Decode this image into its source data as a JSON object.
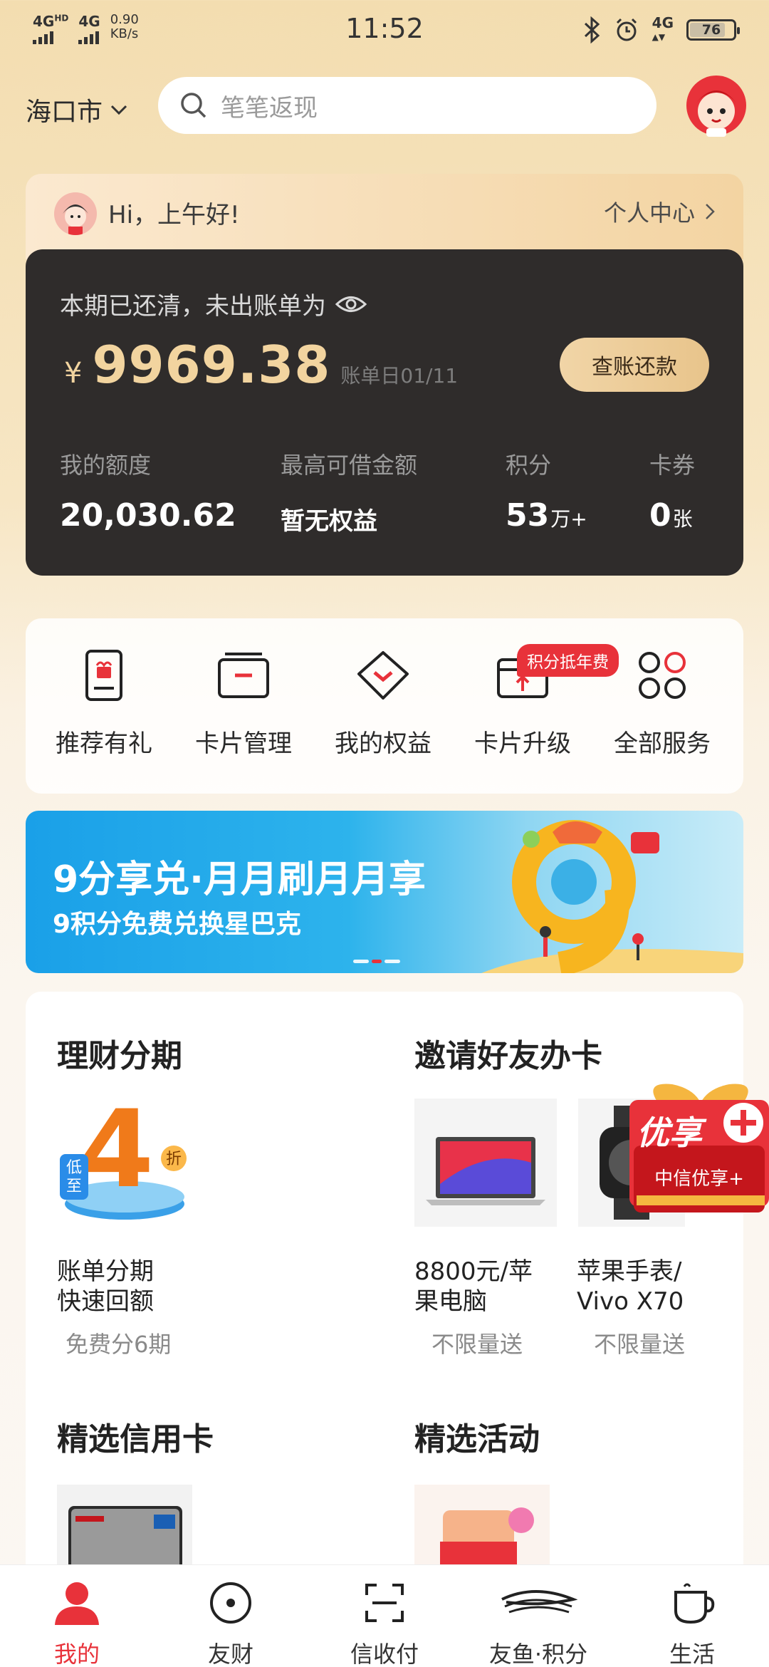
{
  "status_bar": {
    "sig1": "4G",
    "sig1_sup": "HD",
    "sig2": "4G",
    "speed_value": "0.90",
    "speed_unit": "KB/s",
    "time": "11:52",
    "net_right": "4G",
    "battery": "76"
  },
  "header": {
    "city": "海口市",
    "search_placeholder": "笔笔返现"
  },
  "account": {
    "greeting": "Hi，上午好!",
    "profile_link": "个人中心",
    "bill_status": "本期已还清，未出账单为",
    "currency": "¥",
    "amount": "9969.38",
    "due_label": "账单日01/11",
    "pay_button": "查账还款",
    "stats": [
      {
        "label": "我的额度",
        "value": "20,030.62",
        "unit": ""
      },
      {
        "label": "最高可借金额",
        "value": "暂无权益",
        "unit": ""
      },
      {
        "label": "积分",
        "value": "53",
        "unit": "万+"
      },
      {
        "label": "卡券",
        "value": "0",
        "unit": "张"
      }
    ]
  },
  "services": {
    "badge": "积分抵年费",
    "items": [
      {
        "label": "推荐有礼",
        "icon": "gift-box-icon"
      },
      {
        "label": "卡片管理",
        "icon": "card-icon"
      },
      {
        "label": "我的权益",
        "icon": "diamond-icon"
      },
      {
        "label": "卡片升级",
        "icon": "card-upgrade-icon"
      },
      {
        "label": "全部服务",
        "icon": "grid-icon"
      }
    ]
  },
  "banner": {
    "title": "9分享兑·月月刷月月享",
    "subtitle": "9积分免费兑换星巴克"
  },
  "sections": {
    "finance_title": "理财分期",
    "invite_title": "邀请好友办卡",
    "finance_product": {
      "badge_top": "低",
      "badge_bottom": "至",
      "number": "4",
      "discount": "折",
      "name_line1": "账单分期",
      "name_line2": "快速回额",
      "tag": "免费分6期"
    },
    "invite_products": [
      {
        "name_line1": "8800元/苹",
        "name_line2": "果电脑",
        "tag": "不限量送"
      },
      {
        "name_line1": "苹果手表/",
        "name_line2": "Vivo X70",
        "tag": "不限量送"
      }
    ],
    "cards_title": "精选信用卡",
    "activity_title": "精选活动"
  },
  "float_ad": {
    "title": "优享",
    "subtitle": "中信优享+"
  },
  "bottom_nav": [
    {
      "label": "我的",
      "icon": "person-icon",
      "active": true
    },
    {
      "label": "友财",
      "icon": "coin-icon",
      "active": false
    },
    {
      "label": "信收付",
      "icon": "scan-icon",
      "active": false
    },
    {
      "label": "友鱼·积分",
      "icon": "fish-icon",
      "active": false
    },
    {
      "label": "生活",
      "icon": "cup-icon",
      "active": false
    }
  ],
  "colors": {
    "accent": "#e8323a",
    "gold": "#f2d49f",
    "card_dark": "#2f2c2b"
  }
}
